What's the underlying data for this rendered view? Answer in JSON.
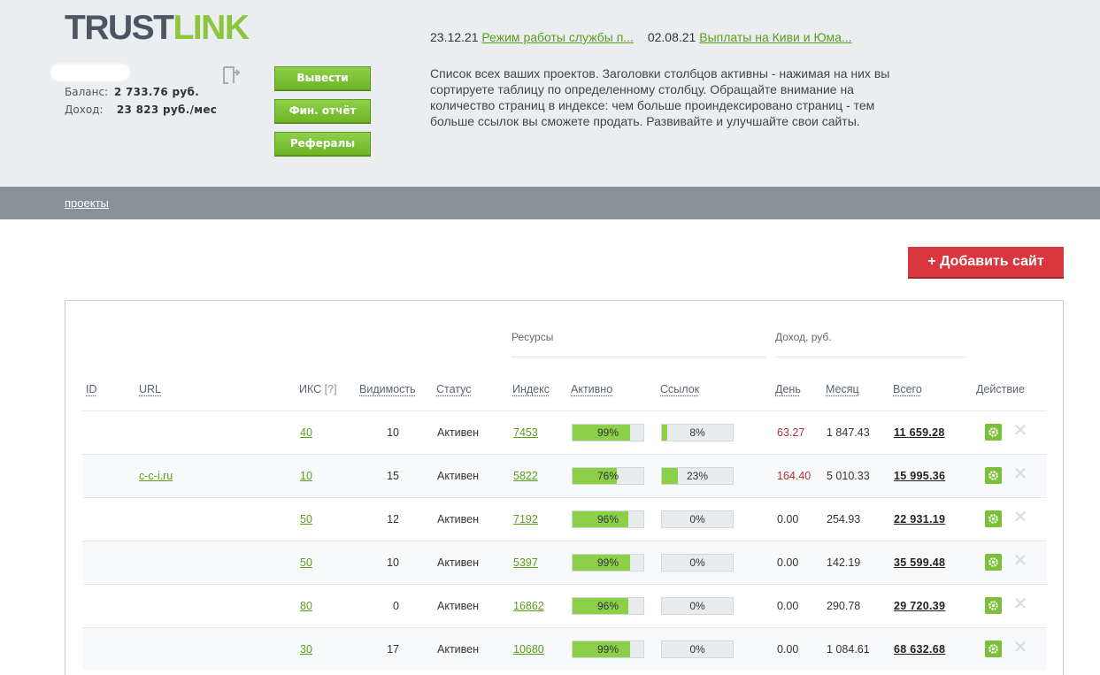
{
  "logo": {
    "part1": "TRUST",
    "part2": "LINK"
  },
  "account": {
    "balance_label": "Баланс:",
    "balance_value": "2 733.76  руб.",
    "income_label": "Доход:",
    "income_value": "23 823 руб./мес"
  },
  "buttons": {
    "withdraw": "Вывести",
    "fin_report": "Фин. отчёт",
    "referrals": "Рефералы"
  },
  "news": [
    {
      "date": "23.12.21",
      "title": "Режим работы службы п..."
    },
    {
      "date": "02.08.21",
      "title": "Выплаты на Киви и Юма..."
    }
  ],
  "info_text": "Список всех ваших проектов. Заголовки столбцов активны - нажимая на них вы сортируете таблицу по определенному столбцу. Обращайте внимание на количество страниц в индексе: чем больше проиндексировано страниц - тем больше ссылок вы сможете продать. Развивайте и улучшайте свои сайты.",
  "nav": {
    "projects": "проекты"
  },
  "add_site_label": "+ Добавить сайт",
  "table": {
    "groups": {
      "resources": "Ресурсы",
      "income": "Доход,  руб."
    },
    "headers": {
      "id": "ID",
      "url": "URL",
      "iks": "ИКС",
      "iks_help": "[?]",
      "visibility": "Видимость",
      "status": "Статус",
      "index": "Индекс",
      "active": "Активно",
      "links": "Ссылок",
      "day": "День",
      "month": "Месяц",
      "total": "Всего",
      "action": "Действие"
    },
    "rows": [
      {
        "url": "",
        "iks": "40",
        "visibility": "10",
        "status": "Активен",
        "index": "7453",
        "active": "99%",
        "active_pct": 99,
        "links": "8%",
        "links_pct": 8,
        "day": "63.27",
        "day_red": true,
        "month": "1 847.43",
        "total": "11 659.28"
      },
      {
        "url": "c-c-i.ru",
        "iks": "10",
        "visibility": "15",
        "status": "Активен",
        "index": "5822",
        "active": "76%",
        "active_pct": 76,
        "links": "23%",
        "links_pct": 23,
        "day": "164.40",
        "day_red": true,
        "month": "5 010.33",
        "total": "15 995.36"
      },
      {
        "url": "",
        "iks": "50",
        "visibility": "12",
        "status": "Активен",
        "index": "7192",
        "active": "96%",
        "active_pct": 96,
        "links": "0%",
        "links_pct": 0,
        "day": "0.00",
        "day_red": false,
        "month": "254.93",
        "total": "22 931.19"
      },
      {
        "url": "",
        "iks": "50",
        "visibility": "10",
        "status": "Активен",
        "index": "5397",
        "active": "99%",
        "active_pct": 99,
        "links": "0%",
        "links_pct": 0,
        "day": "0.00",
        "day_red": false,
        "month": "142.19",
        "total": "35 599.48"
      },
      {
        "url": "",
        "iks": "80",
        "visibility": "0",
        "status": "Активен",
        "index": "16862",
        "active": "96%",
        "active_pct": 96,
        "links": "0%",
        "links_pct": 0,
        "day": "0.00",
        "day_red": false,
        "month": "290.78",
        "total": "29 720.39"
      },
      {
        "url": "",
        "iks": "30",
        "visibility": "17",
        "status": "Активен",
        "index": "10680",
        "active": "99%",
        "active_pct": 99,
        "links": "0%",
        "links_pct": 0,
        "day": "0.00",
        "day_red": false,
        "month": "1 084.61",
        "total": "68 632.68"
      }
    ]
  },
  "colors": {
    "accent_green": "#8cc63f",
    "link_green": "#5a9e1c",
    "add_button_red": "#d9363e",
    "navbar_gray": "#899196",
    "day_red": "#b0303a"
  }
}
